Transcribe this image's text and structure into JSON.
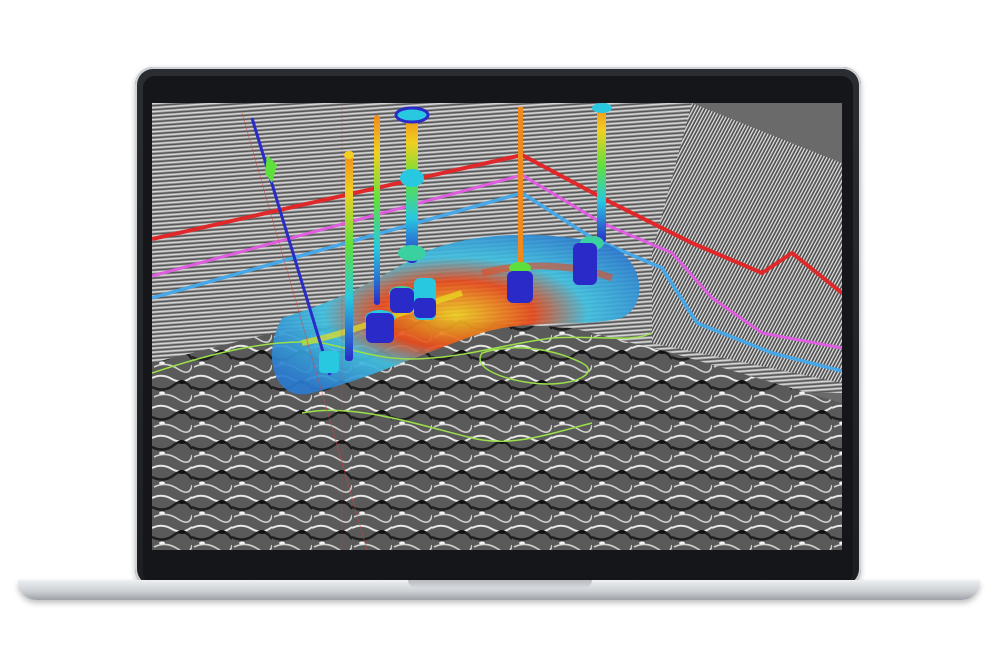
{
  "colors": {
    "screen_bg": "#6b6b6b",
    "horizon_red": "#e0282a",
    "horizon_magenta": "#e05ce0",
    "horizon_blue": "#46a8e8",
    "outline_green": "#9be04a",
    "well_orange": "#f08a1c",
    "nav_arrow": "#3ccf3a"
  },
  "icons": {
    "nav": "compass-arrow-icon"
  }
}
